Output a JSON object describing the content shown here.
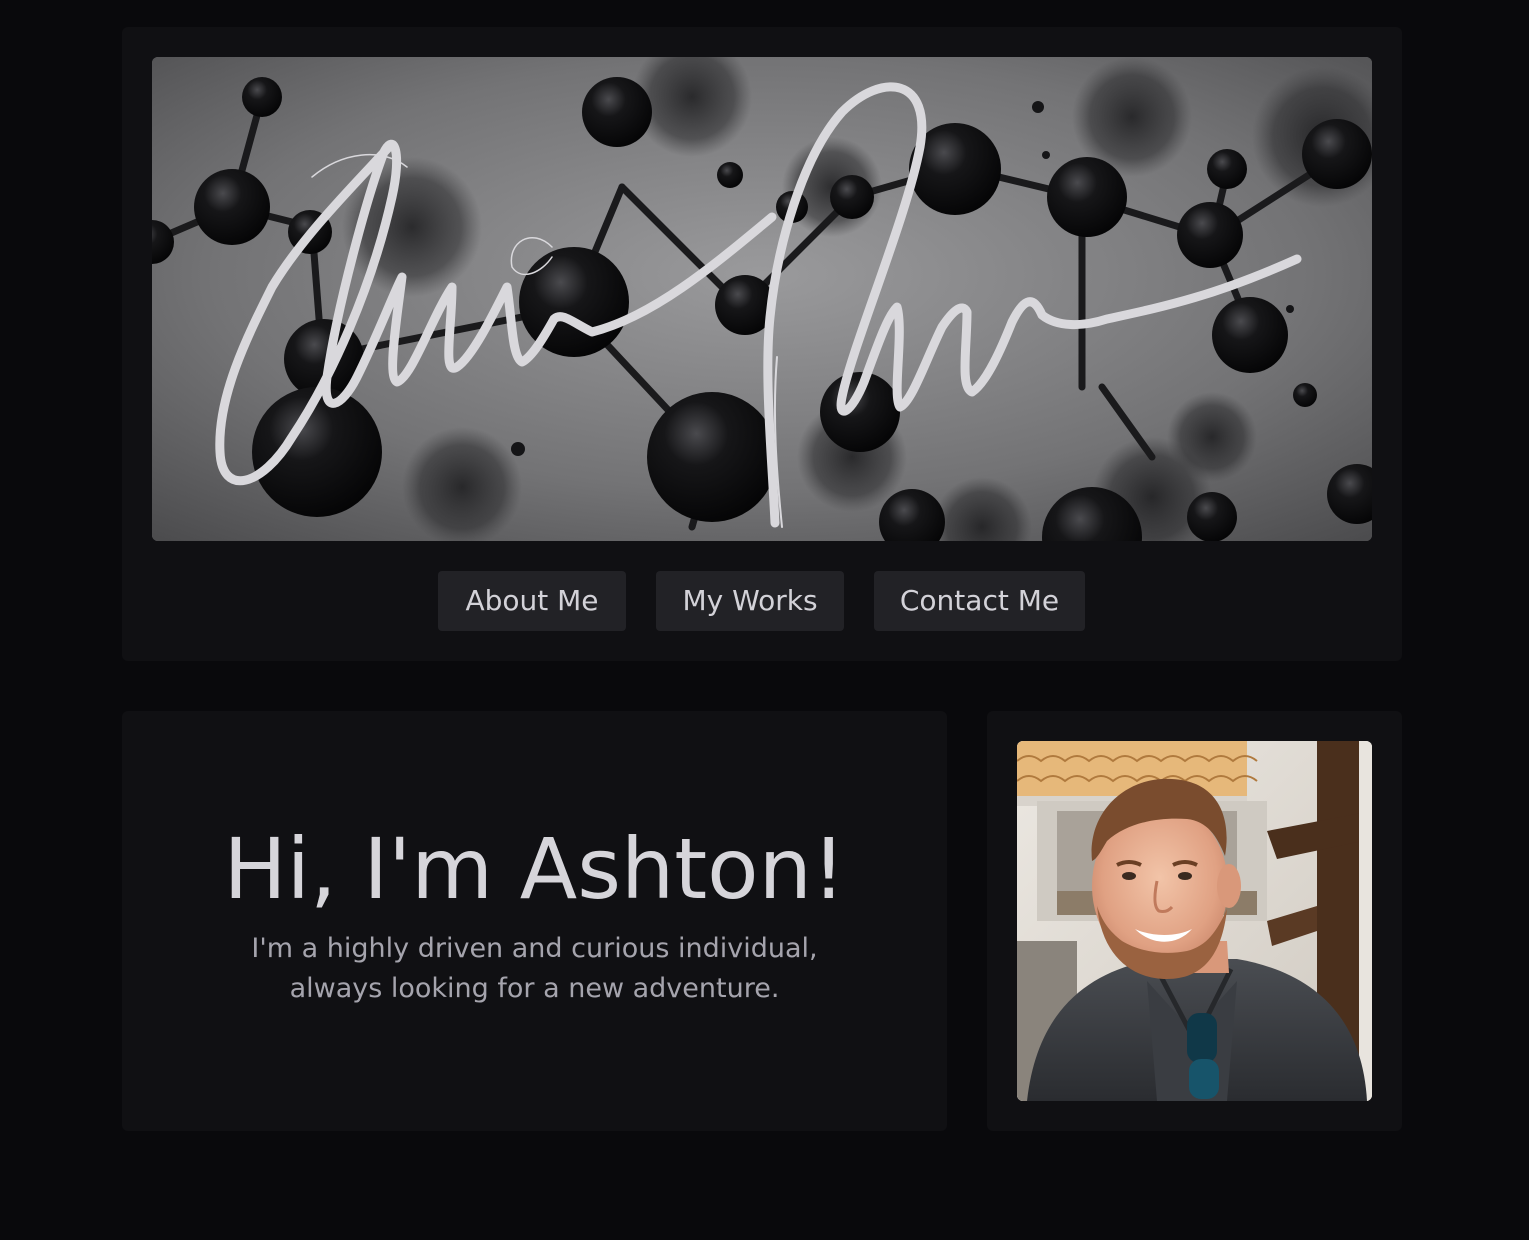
{
  "header": {
    "banner_alt": "Signature banner"
  },
  "nav": {
    "items": [
      {
        "label": "About Me"
      },
      {
        "label": "My Works"
      },
      {
        "label": "Contact Me"
      }
    ]
  },
  "intro": {
    "heading": "Hi, I'm Ashton!",
    "text_lines": [
      "I'm a highly driven and curious individual,",
      "always looking for a new adventure."
    ]
  },
  "photo": {
    "alt": "Portrait of Ashton"
  },
  "colors": {
    "page_background": "#09090c",
    "card_background": "#101013",
    "button_background": "#222226",
    "heading_text": "#d6d5da",
    "body_text": "#a5a4ad"
  }
}
